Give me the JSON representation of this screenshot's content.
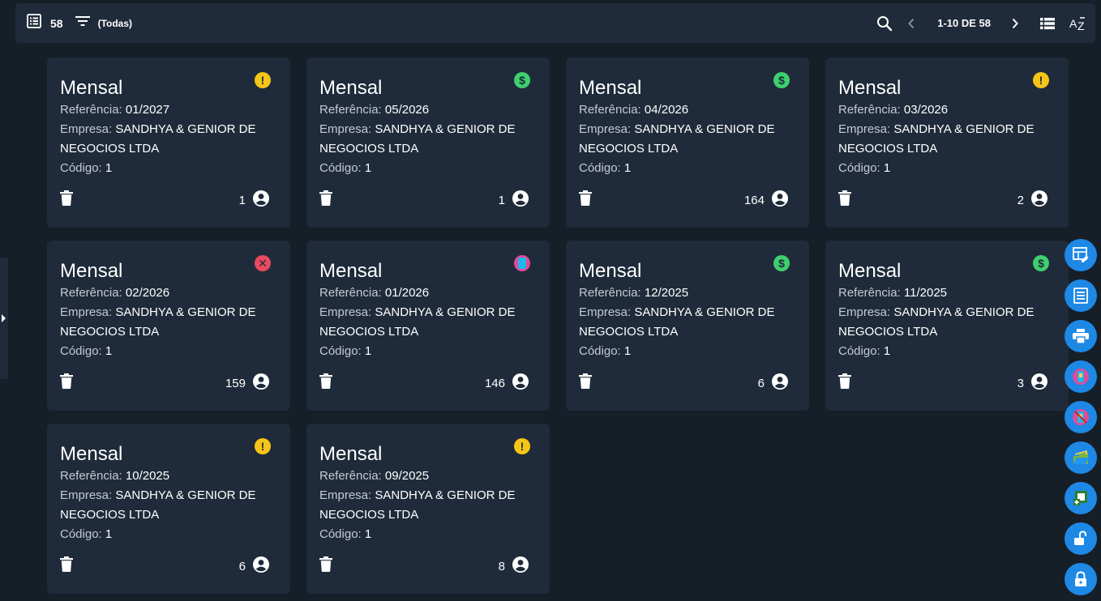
{
  "toolbar": {
    "count": "58",
    "filter_label": "(Todas)",
    "pagination": "1-10 DE 58"
  },
  "labels": {
    "referencia": "Referência:",
    "empresa": "Empresa:",
    "codigo": "Código:"
  },
  "cards": [
    {
      "title": "Mensal",
      "referencia": "01/2027",
      "empresa": "SANDHYA & GENIOR DE NEGOCIOS LTDA",
      "codigo": "1",
      "users": "1",
      "status": "warning-icon"
    },
    {
      "title": "Mensal",
      "referencia": "05/2026",
      "empresa": "SANDHYA & GENIOR DE NEGOCIOS LTDA",
      "codigo": "1",
      "users": "1",
      "status": "paid-icon"
    },
    {
      "title": "Mensal",
      "referencia": "04/2026",
      "empresa": "SANDHYA & GENIOR DE NEGOCIOS LTDA",
      "codigo": "1",
      "users": "164",
      "status": "paid-icon"
    },
    {
      "title": "Mensal",
      "referencia": "03/2026",
      "empresa": "SANDHYA & GENIOR DE NEGOCIOS LTDA",
      "codigo": "1",
      "users": "2",
      "status": "warning-icon"
    },
    {
      "title": "Mensal",
      "referencia": "02/2026",
      "empresa": "SANDHYA & GENIOR DE NEGOCIOS LTDA",
      "codigo": "1",
      "users": "159",
      "status": "error-icon"
    },
    {
      "title": "Mensal",
      "referencia": "01/2026",
      "empresa": "SANDHYA & GENIOR DE NEGOCIOS LTDA",
      "codigo": "1",
      "users": "146",
      "status": "pix-icon"
    },
    {
      "title": "Mensal",
      "referencia": "12/2025",
      "empresa": "SANDHYA & GENIOR DE NEGOCIOS LTDA",
      "codigo": "1",
      "users": "6",
      "status": "paid-icon"
    },
    {
      "title": "Mensal",
      "referencia": "11/2025",
      "empresa": "SANDHYA & GENIOR DE NEGOCIOS LTDA",
      "codigo": "1",
      "users": "3",
      "status": "paid-icon"
    },
    {
      "title": "Mensal",
      "referencia": "10/2025",
      "empresa": "SANDHYA & GENIOR DE NEGOCIOS LTDA",
      "codigo": "1",
      "users": "6",
      "status": "warning-icon"
    },
    {
      "title": "Mensal",
      "referencia": "09/2025",
      "empresa": "SANDHYA & GENIOR DE NEGOCIOS LTDA",
      "codigo": "1",
      "users": "8",
      "status": "warning-icon"
    }
  ],
  "fabs": [
    "edit-table-icon",
    "list-icon",
    "print-icon",
    "pix-icon",
    "pix-cancel-icon",
    "folder-icon",
    "add-document-icon",
    "unlock-icon",
    "lock-icon"
  ],
  "colors": {
    "accent": "#1e88e5",
    "warning": "#f5c518",
    "paid": "#3ecf6e",
    "error": "#e84a5f"
  }
}
